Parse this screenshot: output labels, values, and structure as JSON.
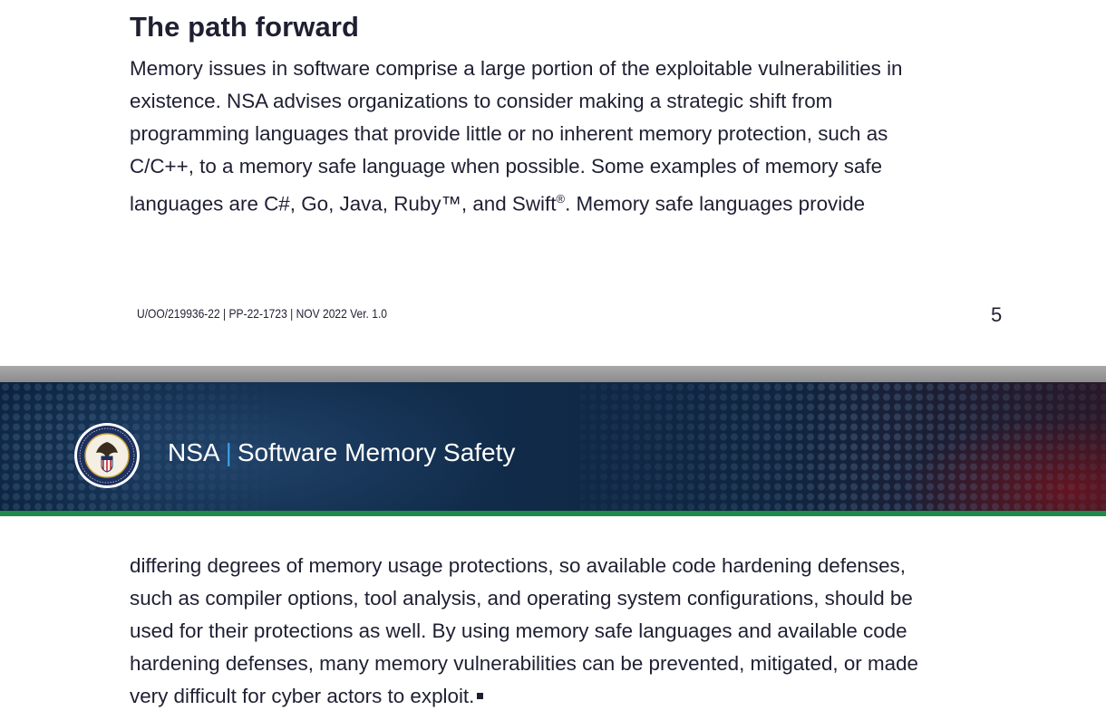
{
  "page_top": {
    "heading": "The path forward",
    "paragraph_lines": [
      "Memory issues in software comprise a large portion of the exploitable vulnerabilities in",
      "existence. NSA advises organizations to consider making a strategic shift from",
      "programming languages that provide little or no inherent memory protection, such as",
      "C/C++, to a memory safe language when possible. Some examples of memory safe"
    ],
    "last_line_before": "languages are C#, Go, Java, Ruby™, and Swift",
    "last_line_sup": "®",
    "last_line_after": ". Memory safe languages provide",
    "footer_id": "U/OO/219936-22 | PP-22-1723 | NOV 2022 Ver. 1.0",
    "page_number": "5"
  },
  "banner": {
    "org": "NSA",
    "separator": "|",
    "title": "Software Memory Safety",
    "seal_icon": "nsa-seal-icon",
    "accent_color": "#3aa0e6",
    "stripe_color": "#1f8a4c"
  },
  "page_bottom": {
    "paragraph_lines": [
      "differing degrees of memory usage protections, so available code hardening defenses,",
      "such as compiler options, tool analysis, and operating system configurations, should be",
      "used for their protections as well. By using memory safe languages and available code",
      "hardening defenses, many memory vulnerabilities can be prevented, mitigated, or made"
    ],
    "last_line": "very difficult for cyber actors to exploit."
  }
}
